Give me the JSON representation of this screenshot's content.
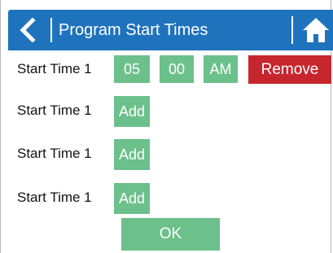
{
  "header": {
    "title": "Program Start Times"
  },
  "icons": {
    "back": "chevron-left-icon",
    "home": "home-icon"
  },
  "colors": {
    "header": "#1f73bd",
    "green": "#6cc08b",
    "remove": "#c8262e"
  },
  "start_times": [
    {
      "label": "Start Time 1",
      "hour": "05",
      "minute": "00",
      "ampm": "AM",
      "action": "Remove"
    },
    {
      "label": "Start Time 1",
      "action": "Add"
    },
    {
      "label": "Start Time 1",
      "action": "Add"
    },
    {
      "label": "Start Time 1",
      "action": "Add"
    }
  ],
  "ok_label": "OK"
}
